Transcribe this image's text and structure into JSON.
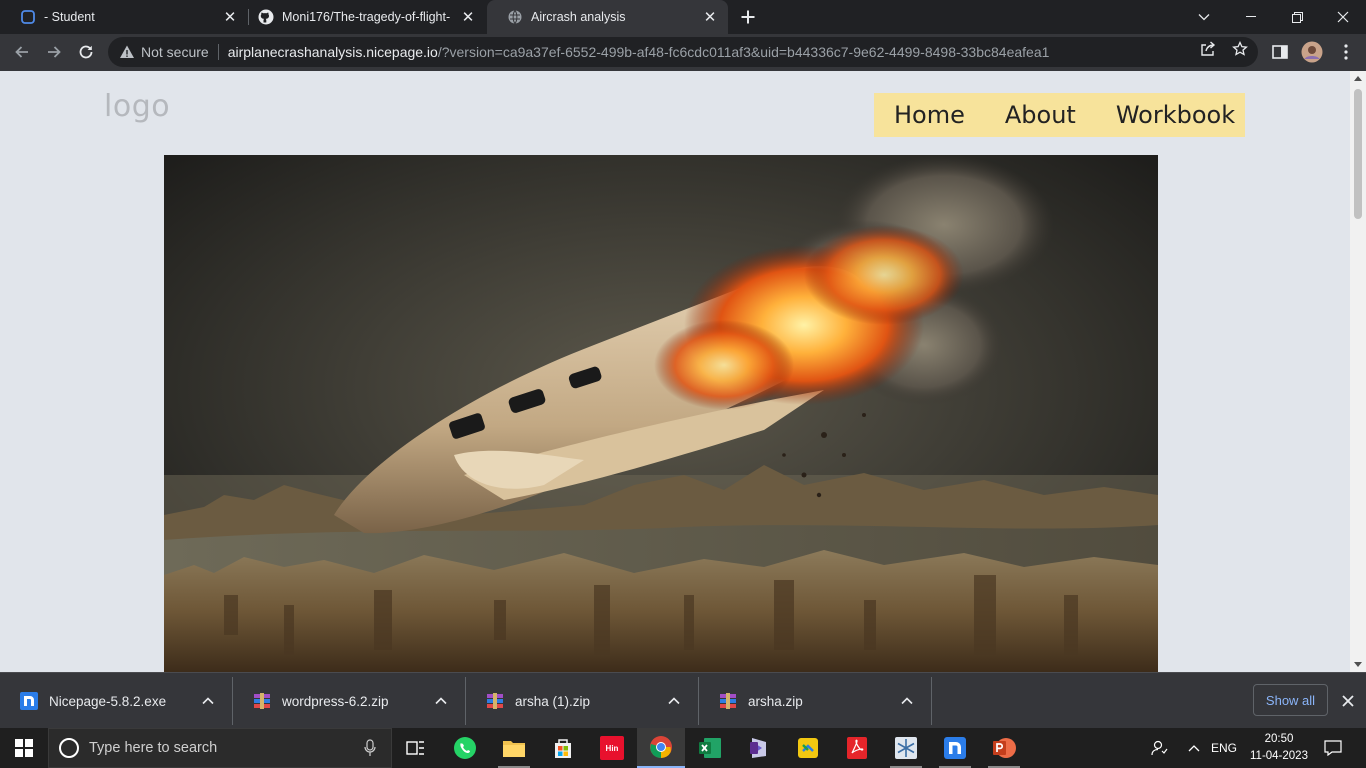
{
  "browser": {
    "tabs": [
      {
        "title": "- Student",
        "active": false
      },
      {
        "title": "Moni176/The-tragedy-of-flight-",
        "active": false
      },
      {
        "title": "Aircrash analysis",
        "active": true
      }
    ],
    "address": {
      "security_label": "Not secure",
      "host": "airplanecrashanalysis.nicepage.io",
      "rest": "/?version=ca9a37ef-6552-499b-af48-fc6cdc011af3&uid=b44336c7-9e62-4499-8498-33bc84eafea1"
    }
  },
  "page": {
    "logo_text": "logo",
    "nav": [
      "Home",
      "About",
      "Workbook"
    ],
    "hero_image": "burning-plane-crash-over-city"
  },
  "downloads": {
    "items": [
      {
        "name": "Nicepage-5.8.2.exe",
        "icon": "nicepage-icon"
      },
      {
        "name": "wordpress-6.2.zip",
        "icon": "zip-archive-icon"
      },
      {
        "name": "arsha (1).zip",
        "icon": "zip-archive-icon"
      },
      {
        "name": "arsha.zip",
        "icon": "zip-archive-icon"
      }
    ],
    "show_all_label": "Show all"
  },
  "taskbar": {
    "search_placeholder": "Type here to search",
    "hindi_label": "Hin",
    "language": "ENG",
    "time": "20:50",
    "date": "11-04-2023"
  },
  "colors": {
    "nav_background": "#f7e39b",
    "page_background": "#e1e5eb",
    "chrome_dark": "#202124",
    "chrome_toolbar": "#35363a",
    "link_blue": "#8ab4f8"
  }
}
